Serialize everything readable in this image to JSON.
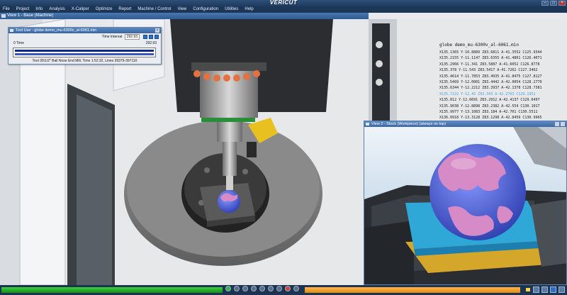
{
  "app": {
    "title": "VERICUT"
  },
  "menu": [
    "File",
    "Project",
    "Info",
    "Analysis",
    "X-Caliper",
    "Optimize",
    "Report",
    "Machine / Control",
    "View",
    "Configuration",
    "Utilities",
    "Help"
  ],
  "view1": {
    "title": "View 1 - Base (Machine)"
  },
  "tool_window": {
    "title": "Tool Use - globe demo_mu-6300v_al-6061.min",
    "time_interval_label": "Time Interval",
    "time_interval_value": "292.93",
    "start_label": "0 Time",
    "end_value": "292.93",
    "footer": "Tool 30\\1/2\" Ball Nose End Mill, Time 1:52:32, Lines 39379-397110"
  },
  "nc_listing": {
    "filename": "globe demo_mu-6300v_al-6061.min",
    "lines": [
      "X135.1365 Y-10.8889 Z83.6811 A-41.3552 C125.9344",
      "X135.2155 Y-11.1147 Z83.6355 A-41.4801 C126.4071",
      "X135.2966 Y-11.341 Z83.5887 A-41.6052 C126.8778",
      "X135.378 Y-11.543 Z83.5417 A-41.7262 C127.3462",
      "X135.4614 Y-11.7853 Z83.4935 A-41.8475 C127.8127",
      "X135.5469 Y-12.0081 Z83.4442 A-42.0054 C128.2770",
      "X135.6344 Y-12.2212 Z83.3937 A-42.1378 C128.7381",
      "X135.7222 Y-12.45 Z83.343 A-42.2763 C129.1951",
      "X135.812 Y-12.6691 Z83.2912 A-42.4137 C129.6497",
      "X135.9038 Y-12.8898 Z83.2382 A-42.554 C130.1017",
      "X135.9977 Y-13.1083 Z83.184 A-42.701 C130.5511",
      "X136.0918 Y-13.3128 Z83.1298 A-42.8459 C130.9965",
      "X136.1878 Y-13.5295 Z83.0743 A-42.9935 C131.4390",
      "X136.286 Y-13.7553 Z83.0177 A-43.1438 C131.8787",
      "X136.3861 Y-13.9713 Z82.9599 A-43.2968 C132.3146"
    ],
    "highlight_index": 7
  },
  "view2": {
    "title": "View 2 - Stock (Workpiece) (always on top)"
  },
  "progress": {
    "main_fraction": 0.39,
    "secondary_fraction": 0.38
  },
  "colors": {
    "accent": "#2f5a92",
    "progress_green": "#2db84a",
    "progress_orange": "#f5a623",
    "globe_pink": "#d68ac6",
    "globe_blue": "#5a70d8",
    "stock_cyan": "#2fa8d8"
  }
}
